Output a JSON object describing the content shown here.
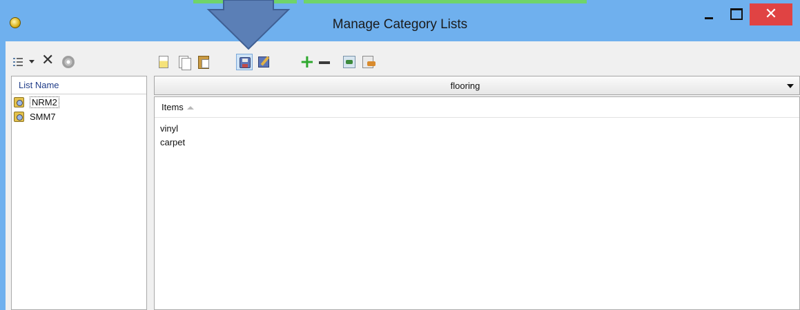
{
  "window": {
    "title": "Manage Category Lists",
    "close_glyph": "✕"
  },
  "colors": {
    "frame": "#6fb0ee",
    "close_button": "#e04343",
    "arrow": "#5b7fb6",
    "list_header_text": "#1f3c88"
  },
  "toolbar": {
    "left_icons": [
      "list-view-icon",
      "dropdown-arrow-icon",
      "delete-icon",
      "settings-gear-icon"
    ],
    "right_icons": [
      "new-icon",
      "copy-icon",
      "paste-icon",
      "save-icon",
      "edit-icon",
      "add-icon",
      "remove-icon",
      "import-icon",
      "export-icon"
    ]
  },
  "lists": {
    "header": "List Name",
    "items": [
      {
        "name": "NRM2",
        "selected": true
      },
      {
        "name": "SMM7",
        "selected": false
      }
    ]
  },
  "category": {
    "selected": "flooring"
  },
  "items_table": {
    "header": "Items",
    "rows": [
      "vinyl",
      "carpet"
    ]
  }
}
